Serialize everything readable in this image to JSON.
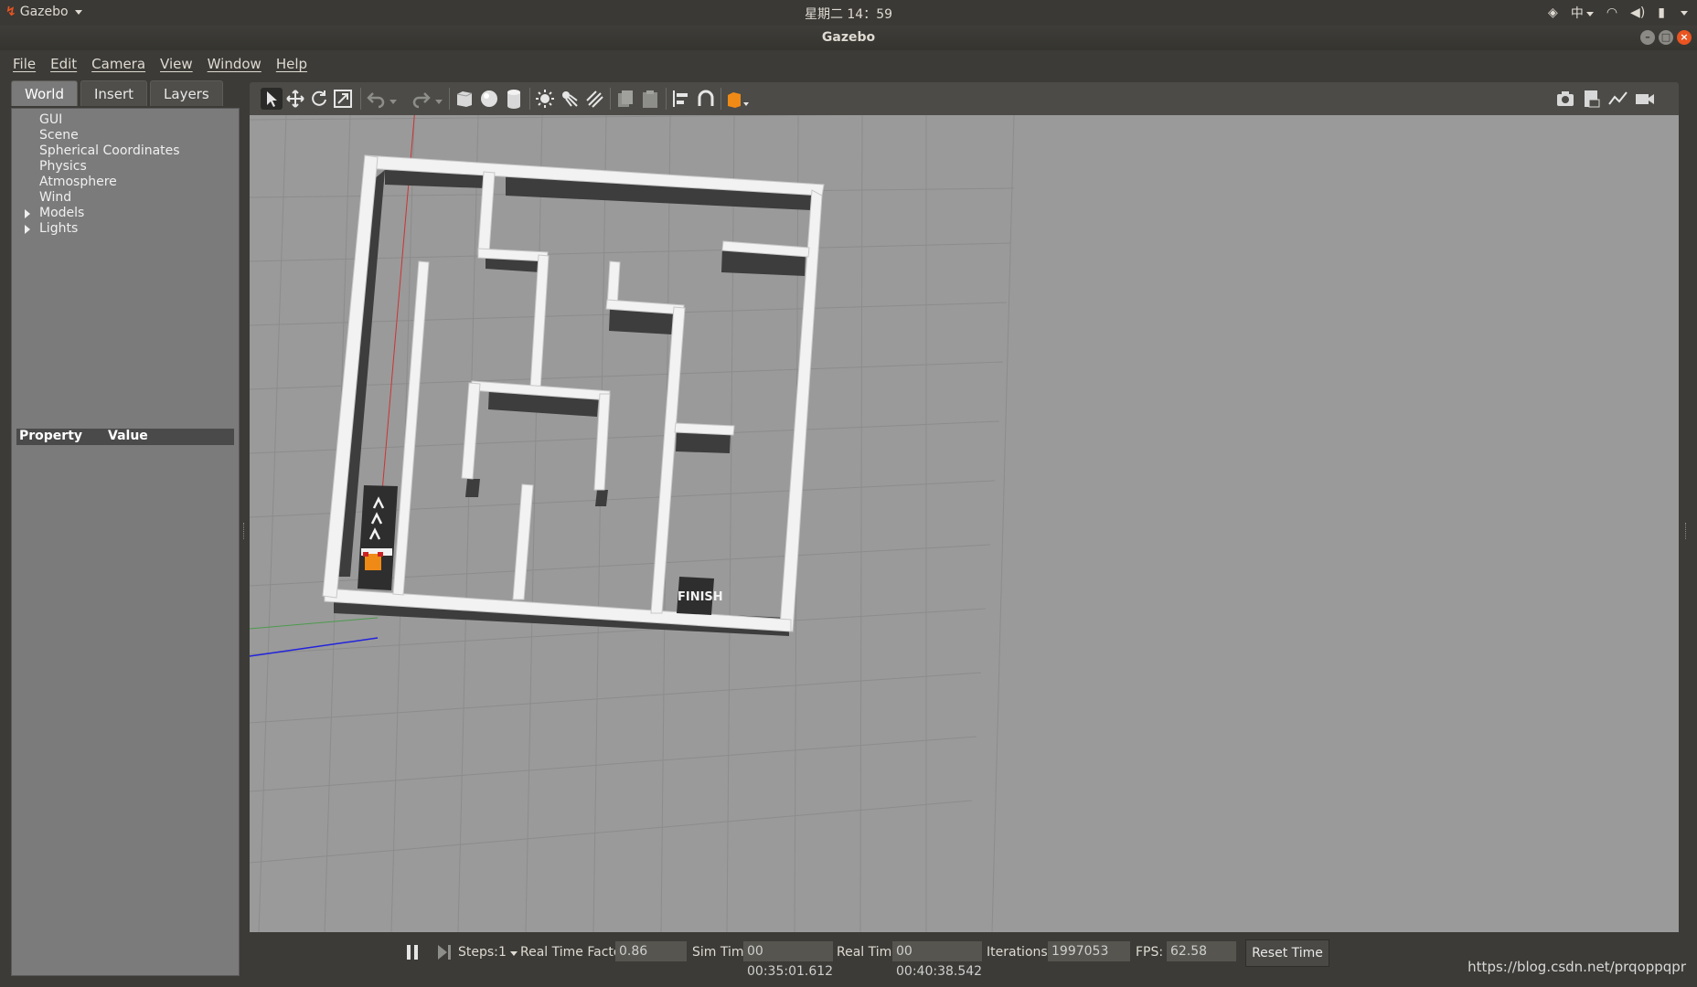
{
  "topbar": {
    "app_name": "Gazebo",
    "clock": "星期二 14：59",
    "input_method": "中"
  },
  "window": {
    "title": "Gazebo"
  },
  "menu": [
    "File",
    "Edit",
    "Camera",
    "View",
    "Window",
    "Help"
  ],
  "left_panel": {
    "tabs": [
      "World",
      "Insert",
      "Layers"
    ],
    "active_tab": "World",
    "tree": [
      {
        "label": "GUI",
        "expandable": false
      },
      {
        "label": "Scene",
        "expandable": false
      },
      {
        "label": "Spherical Coordinates",
        "expandable": false
      },
      {
        "label": "Physics",
        "expandable": false
      },
      {
        "label": "Atmosphere",
        "expandable": false
      },
      {
        "label": "Wind",
        "expandable": false
      },
      {
        "label": "Models",
        "expandable": true
      },
      {
        "label": "Lights",
        "expandable": true
      }
    ],
    "property_header": {
      "property": "Property",
      "value": "Value"
    }
  },
  "toolbar": {
    "icons": [
      "select-icon",
      "translate-icon",
      "rotate-icon",
      "scale-icon",
      "undo-icon",
      "redo-icon",
      "box-icon",
      "sphere-icon",
      "cylinder-icon",
      "point-light-icon",
      "spot-light-icon",
      "directional-light-icon",
      "copy-icon",
      "paste-icon",
      "align-icon",
      "snap-icon",
      "view-angle-icon",
      "screenshot-icon",
      "log-icon",
      "plot-icon",
      "record-icon"
    ]
  },
  "scene": {
    "finish_label": "FINISH",
    "colors": {
      "ground": "#9a9a9a",
      "wall_top": "#f2f2f2",
      "wall_shadow": "#3d3d3d",
      "robot": "#f08a16"
    }
  },
  "status": {
    "steps_label": "Steps:",
    "steps_value": "1",
    "rtf_label": "Real Time Factor:",
    "rtf_value": "0.86",
    "sim_time_label": "Sim Time:",
    "sim_time_value": "00 00:35:01.612",
    "real_time_label": "Real Time:",
    "real_time_value": "00 00:40:38.542",
    "iterations_label": "Iterations:",
    "iterations_value": "1997053",
    "fps_label": "FPS:",
    "fps_value": "62.58",
    "reset_label": "Reset Time"
  },
  "watermark": "https://blog.csdn.net/prqoppqpr"
}
